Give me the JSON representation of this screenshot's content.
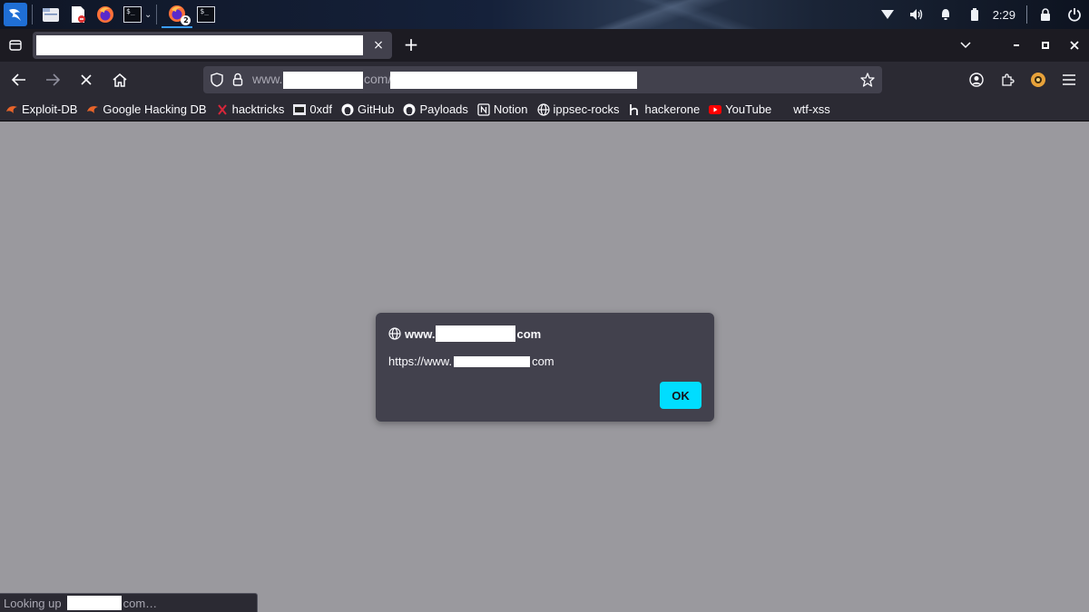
{
  "os_panel": {
    "clock": "2:29",
    "taskbar_badge": "2",
    "terminal_glyph": "$_"
  },
  "browser": {
    "tab": {
      "close_glyph": "×"
    },
    "new_tab_glyph": "+",
    "url": {
      "prefix": "www.",
      "mid": "com/"
    },
    "bookmarks": [
      {
        "label": "Exploit-DB",
        "icon": "exploitdb-icon"
      },
      {
        "label": "Google Hacking DB",
        "icon": "exploitdb-icon"
      },
      {
        "label": "hacktricks",
        "icon": "hacktricks-icon"
      },
      {
        "label": "0xdf",
        "icon": "0xdf-icon"
      },
      {
        "label": "GitHub",
        "icon": "github-icon"
      },
      {
        "label": "Payloads",
        "icon": "github-icon"
      },
      {
        "label": "Notion",
        "icon": "notion-icon"
      },
      {
        "label": "ippsec-rocks",
        "icon": "globe-icon"
      },
      {
        "label": "hackerone",
        "icon": "hackerone-icon"
      },
      {
        "label": "YouTube",
        "icon": "youtube-icon"
      },
      {
        "label": "wtf-xss",
        "icon": ""
      }
    ]
  },
  "dialog": {
    "origin_prefix": "www.",
    "origin_suffix": "com",
    "message_prefix": "https://www.",
    "message_suffix": "com",
    "ok_label": "OK"
  },
  "status": {
    "prefix": "Looking up",
    "suffix": "com…"
  },
  "colors": {
    "content_bg": "#9a999e",
    "toolbar": "#2b2a33",
    "dialog_bg": "#42414d",
    "accent": "#00ddff"
  }
}
